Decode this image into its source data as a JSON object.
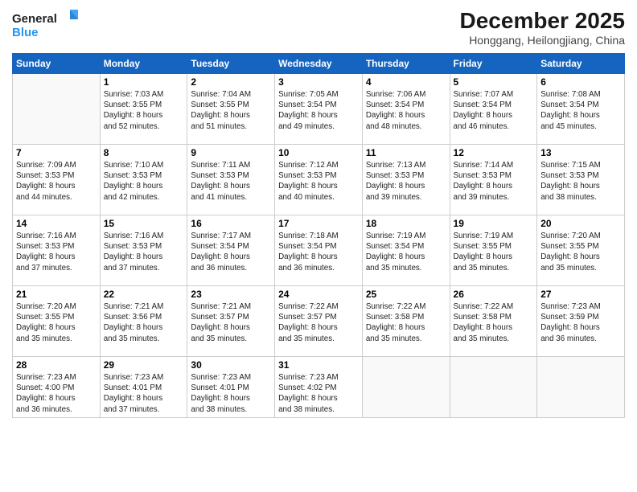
{
  "header": {
    "logo_line1": "General",
    "logo_line2": "Blue",
    "month_year": "December 2025",
    "location": "Honggang, Heilongjiang, China"
  },
  "weekdays": [
    "Sunday",
    "Monday",
    "Tuesday",
    "Wednesday",
    "Thursday",
    "Friday",
    "Saturday"
  ],
  "weeks": [
    [
      {
        "day": "",
        "info": ""
      },
      {
        "day": "1",
        "info": "Sunrise: 7:03 AM\nSunset: 3:55 PM\nDaylight: 8 hours\nand 52 minutes."
      },
      {
        "day": "2",
        "info": "Sunrise: 7:04 AM\nSunset: 3:55 PM\nDaylight: 8 hours\nand 51 minutes."
      },
      {
        "day": "3",
        "info": "Sunrise: 7:05 AM\nSunset: 3:54 PM\nDaylight: 8 hours\nand 49 minutes."
      },
      {
        "day": "4",
        "info": "Sunrise: 7:06 AM\nSunset: 3:54 PM\nDaylight: 8 hours\nand 48 minutes."
      },
      {
        "day": "5",
        "info": "Sunrise: 7:07 AM\nSunset: 3:54 PM\nDaylight: 8 hours\nand 46 minutes."
      },
      {
        "day": "6",
        "info": "Sunrise: 7:08 AM\nSunset: 3:54 PM\nDaylight: 8 hours\nand 45 minutes."
      }
    ],
    [
      {
        "day": "7",
        "info": "Sunrise: 7:09 AM\nSunset: 3:53 PM\nDaylight: 8 hours\nand 44 minutes."
      },
      {
        "day": "8",
        "info": "Sunrise: 7:10 AM\nSunset: 3:53 PM\nDaylight: 8 hours\nand 42 minutes."
      },
      {
        "day": "9",
        "info": "Sunrise: 7:11 AM\nSunset: 3:53 PM\nDaylight: 8 hours\nand 41 minutes."
      },
      {
        "day": "10",
        "info": "Sunrise: 7:12 AM\nSunset: 3:53 PM\nDaylight: 8 hours\nand 40 minutes."
      },
      {
        "day": "11",
        "info": "Sunrise: 7:13 AM\nSunset: 3:53 PM\nDaylight: 8 hours\nand 39 minutes."
      },
      {
        "day": "12",
        "info": "Sunrise: 7:14 AM\nSunset: 3:53 PM\nDaylight: 8 hours\nand 39 minutes."
      },
      {
        "day": "13",
        "info": "Sunrise: 7:15 AM\nSunset: 3:53 PM\nDaylight: 8 hours\nand 38 minutes."
      }
    ],
    [
      {
        "day": "14",
        "info": "Sunrise: 7:16 AM\nSunset: 3:53 PM\nDaylight: 8 hours\nand 37 minutes."
      },
      {
        "day": "15",
        "info": "Sunrise: 7:16 AM\nSunset: 3:53 PM\nDaylight: 8 hours\nand 37 minutes."
      },
      {
        "day": "16",
        "info": "Sunrise: 7:17 AM\nSunset: 3:54 PM\nDaylight: 8 hours\nand 36 minutes."
      },
      {
        "day": "17",
        "info": "Sunrise: 7:18 AM\nSunset: 3:54 PM\nDaylight: 8 hours\nand 36 minutes."
      },
      {
        "day": "18",
        "info": "Sunrise: 7:19 AM\nSunset: 3:54 PM\nDaylight: 8 hours\nand 35 minutes."
      },
      {
        "day": "19",
        "info": "Sunrise: 7:19 AM\nSunset: 3:55 PM\nDaylight: 8 hours\nand 35 minutes."
      },
      {
        "day": "20",
        "info": "Sunrise: 7:20 AM\nSunset: 3:55 PM\nDaylight: 8 hours\nand 35 minutes."
      }
    ],
    [
      {
        "day": "21",
        "info": "Sunrise: 7:20 AM\nSunset: 3:55 PM\nDaylight: 8 hours\nand 35 minutes."
      },
      {
        "day": "22",
        "info": "Sunrise: 7:21 AM\nSunset: 3:56 PM\nDaylight: 8 hours\nand 35 minutes."
      },
      {
        "day": "23",
        "info": "Sunrise: 7:21 AM\nSunset: 3:57 PM\nDaylight: 8 hours\nand 35 minutes."
      },
      {
        "day": "24",
        "info": "Sunrise: 7:22 AM\nSunset: 3:57 PM\nDaylight: 8 hours\nand 35 minutes."
      },
      {
        "day": "25",
        "info": "Sunrise: 7:22 AM\nSunset: 3:58 PM\nDaylight: 8 hours\nand 35 minutes."
      },
      {
        "day": "26",
        "info": "Sunrise: 7:22 AM\nSunset: 3:58 PM\nDaylight: 8 hours\nand 35 minutes."
      },
      {
        "day": "27",
        "info": "Sunrise: 7:23 AM\nSunset: 3:59 PM\nDaylight: 8 hours\nand 36 minutes."
      }
    ],
    [
      {
        "day": "28",
        "info": "Sunrise: 7:23 AM\nSunset: 4:00 PM\nDaylight: 8 hours\nand 36 minutes."
      },
      {
        "day": "29",
        "info": "Sunrise: 7:23 AM\nSunset: 4:01 PM\nDaylight: 8 hours\nand 37 minutes."
      },
      {
        "day": "30",
        "info": "Sunrise: 7:23 AM\nSunset: 4:01 PM\nDaylight: 8 hours\nand 38 minutes."
      },
      {
        "day": "31",
        "info": "Sunrise: 7:23 AM\nSunset: 4:02 PM\nDaylight: 8 hours\nand 38 minutes."
      },
      {
        "day": "",
        "info": ""
      },
      {
        "day": "",
        "info": ""
      },
      {
        "day": "",
        "info": ""
      }
    ]
  ]
}
